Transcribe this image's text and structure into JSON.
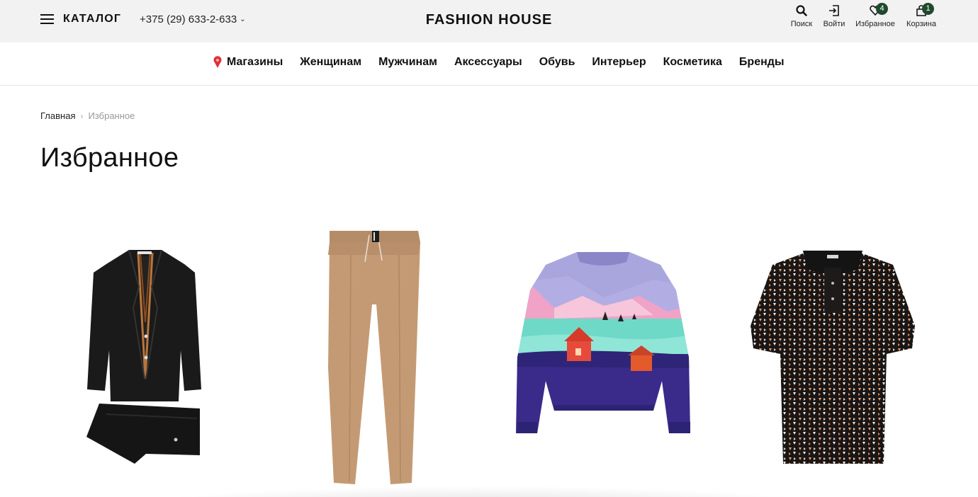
{
  "header": {
    "catalog_label": "КАТАЛОГ",
    "phone": "+375 (29) 633-2-633",
    "logo": "FASHION HOUSE",
    "search_label": "Поиск",
    "login_label": "Войти",
    "favorites_label": "Избранное",
    "favorites_count": "4",
    "cart_label": "Корзина",
    "cart_count": "1",
    "accent_color": "#1f4a2e"
  },
  "nav": {
    "items": [
      "Магазины",
      "Женщинам",
      "Мужчинам",
      "Аксессуары",
      "Обувь",
      "Интерьер",
      "Косметика",
      "Бренды"
    ]
  },
  "breadcrumb": {
    "home": "Главная",
    "current": "Избранное"
  },
  "page": {
    "title": "Избранное"
  },
  "products": [
    {
      "image": "black-suit"
    },
    {
      "image": "beige-trousers"
    },
    {
      "image": "landscape-sweater"
    },
    {
      "image": "patterned-polo"
    }
  ]
}
